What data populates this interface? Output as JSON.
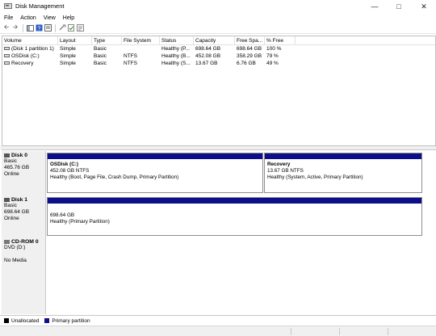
{
  "window": {
    "title": "Disk Management"
  },
  "menu": [
    "File",
    "Action",
    "View",
    "Help"
  ],
  "volume_list": {
    "columns": [
      "Volume",
      "Layout",
      "Type",
      "File System",
      "Status",
      "Capacity",
      "Free Spa...",
      "% Free"
    ],
    "rows": [
      [
        "(Disk 1 partition 1)",
        "Simple",
        "Basic",
        "",
        "Healthy (P...",
        "698.64 GB",
        "698.64 GB",
        "100 %"
      ],
      [
        "OSDisk (C:)",
        "Simple",
        "Basic",
        "NTFS",
        "Healthy (B...",
        "452.08 GB",
        "358.29 GB",
        "79 %"
      ],
      [
        "Recovery",
        "Simple",
        "Basic",
        "NTFS",
        "Healthy (S...",
        "13.67 GB",
        "6.76 GB",
        "49 %"
      ]
    ]
  },
  "disks": [
    {
      "name": "Disk 0",
      "type": "Basic",
      "size": "465.76 GB",
      "status": "Online",
      "partitions": [
        {
          "title": "OSDisk  (C:)",
          "size": "452.08 GB NTFS",
          "status": "Healthy (Boot, Page File, Crash Dump, Primary Partition)"
        },
        {
          "title": "Recovery",
          "size": "13.67 GB NTFS",
          "status": "Healthy (System, Active, Primary Partition)"
        }
      ]
    },
    {
      "name": "Disk 1",
      "type": "Basic",
      "size": "698.64 GB",
      "status": "Online",
      "partitions": [
        {
          "title": "",
          "size": "698.64 GB",
          "status": "Healthy (Primary Partition)"
        }
      ]
    },
    {
      "name": "CD-ROM 0",
      "type": "DVD (D:)",
      "size": "",
      "status": "No Media",
      "partitions": []
    }
  ],
  "legend": [
    {
      "label": "Unallocated",
      "color": "#000000"
    },
    {
      "label": "Primary partition",
      "color": "#0d0e8a"
    }
  ],
  "colors": {
    "primary_partition": "#0d0e8a",
    "unallocated": "#000000"
  }
}
